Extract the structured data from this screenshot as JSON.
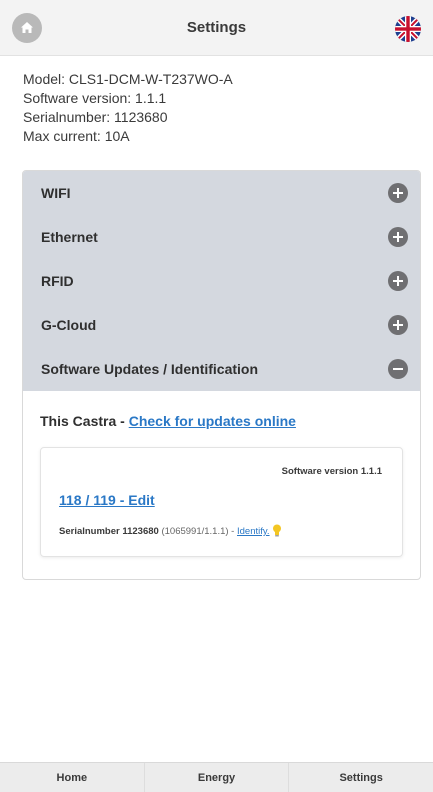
{
  "header": {
    "title": "Settings",
    "home_icon": "home-icon",
    "language_icon": "uk-flag-icon"
  },
  "device_info": {
    "model": "Model: CLS1-DCM-W-T237WO-A",
    "software_version": "Software version: 1.1.1",
    "serialnumber": "Serialnumber: 1123680",
    "max_current": "Max current: 10A"
  },
  "accordion": {
    "sections": [
      {
        "label": "WIFI",
        "expanded": false
      },
      {
        "label": "Ethernet",
        "expanded": false
      },
      {
        "label": "RFID",
        "expanded": false
      },
      {
        "label": "G-Cloud",
        "expanded": false
      },
      {
        "label": "Software Updates / Identification",
        "expanded": true
      }
    ],
    "panel": {
      "this_castra": "This Castra - ",
      "check_updates_link": "Check for updates online",
      "card": {
        "software_version": "Software version 1.1.1",
        "edit_link": "118 / 119 - Edit",
        "serial_bold": "Serialnumber 1123680",
        "serial_detail": " (1065991/1.1.1) - ",
        "identify_link": "Identify."
      }
    }
  },
  "bottom_nav": {
    "items": [
      "Home",
      "Energy",
      "Settings"
    ]
  },
  "colors": {
    "accent_link": "#2a78c6",
    "accordion_header": "#d4d8df",
    "toggle": "#6f6f72"
  }
}
